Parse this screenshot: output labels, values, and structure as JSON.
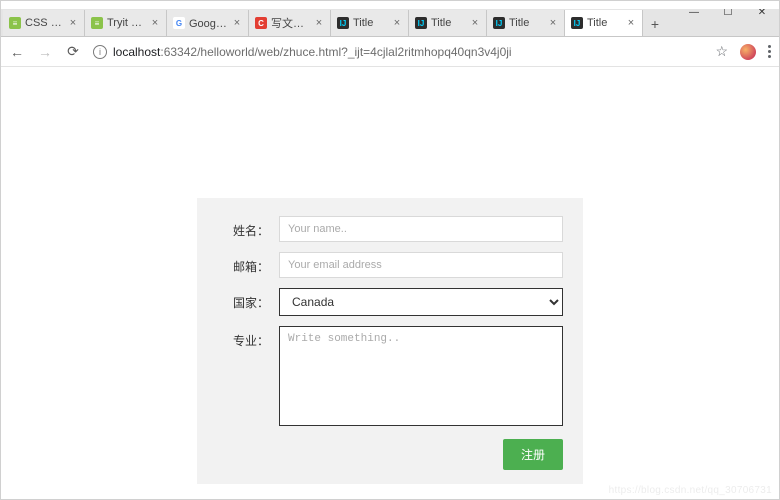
{
  "window": {
    "minimize": "—",
    "maximize": "☐",
    "close": "✕"
  },
  "tabs": [
    {
      "title": "CSS Forms",
      "fav_bg": "#8bc34a",
      "fav_fg": "#fff",
      "fav_txt": "≡"
    },
    {
      "title": "Tryit Editor v",
      "fav_bg": "#8bc34a",
      "fav_fg": "#fff",
      "fav_txt": "≡"
    },
    {
      "title": "Google 翻译",
      "fav_bg": "#ffffff",
      "fav_fg": "#4285f4",
      "fav_txt": "G"
    },
    {
      "title": "写文章-CSDN",
      "fav_bg": "#e33e33",
      "fav_fg": "#fff",
      "fav_txt": "C"
    },
    {
      "title": "Title",
      "fav_bg": "#2d2d2d",
      "fav_fg": "#00d2ff",
      "fav_txt": "IJ"
    },
    {
      "title": "Title",
      "fav_bg": "#2d2d2d",
      "fav_fg": "#00d2ff",
      "fav_txt": "IJ"
    },
    {
      "title": "Title",
      "fav_bg": "#2d2d2d",
      "fav_fg": "#00d2ff",
      "fav_txt": "IJ"
    },
    {
      "title": "Title",
      "fav_bg": "#2d2d2d",
      "fav_fg": "#00d2ff",
      "fav_txt": "IJ"
    }
  ],
  "tabs_active_index": 7,
  "tab_close_glyph": "×",
  "tab_new_glyph": "+",
  "toolbar": {
    "back": "←",
    "forward": "→",
    "reload": "⟳",
    "info": "i",
    "url_host": "localhost",
    "url_rest": ":63342/helloworld/web/zhuce.html?_ijt=4cjlal2ritmhopq40qn3v4j0ji",
    "star": "☆"
  },
  "form": {
    "name_label": "姓名：",
    "name_placeholder": "Your name..",
    "email_label": "邮箱：",
    "email_placeholder": "Your email address",
    "country_label": "国家：",
    "country_value": "Canada",
    "major_label": "专业：",
    "major_placeholder": "Write something..",
    "submit_label": "注册"
  },
  "watermark": "https://blog.csdn.net/qq_30706731"
}
